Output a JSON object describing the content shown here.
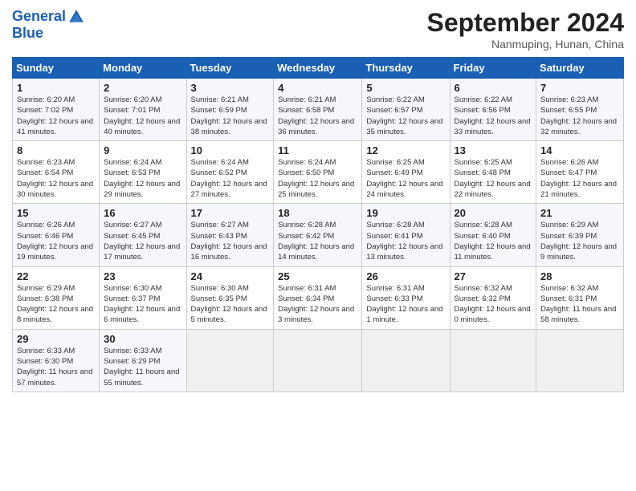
{
  "header": {
    "logo_line1": "General",
    "logo_line2": "Blue",
    "month": "September 2024",
    "location": "Nanmuping, Hunan, China"
  },
  "weekdays": [
    "Sunday",
    "Monday",
    "Tuesday",
    "Wednesday",
    "Thursday",
    "Friday",
    "Saturday"
  ],
  "weeks": [
    [
      {
        "day": "1",
        "rise": "6:20 AM",
        "set": "7:02 PM",
        "daylight": "12 hours and 41 minutes."
      },
      {
        "day": "2",
        "rise": "6:20 AM",
        "set": "7:01 PM",
        "daylight": "12 hours and 40 minutes."
      },
      {
        "day": "3",
        "rise": "6:21 AM",
        "set": "6:59 PM",
        "daylight": "12 hours and 38 minutes."
      },
      {
        "day": "4",
        "rise": "6:21 AM",
        "set": "6:58 PM",
        "daylight": "12 hours and 36 minutes."
      },
      {
        "day": "5",
        "rise": "6:22 AM",
        "set": "6:57 PM",
        "daylight": "12 hours and 35 minutes."
      },
      {
        "day": "6",
        "rise": "6:22 AM",
        "set": "6:56 PM",
        "daylight": "12 hours and 33 minutes."
      },
      {
        "day": "7",
        "rise": "6:23 AM",
        "set": "6:55 PM",
        "daylight": "12 hours and 32 minutes."
      }
    ],
    [
      {
        "day": "8",
        "rise": "6:23 AM",
        "set": "6:54 PM",
        "daylight": "12 hours and 30 minutes."
      },
      {
        "day": "9",
        "rise": "6:24 AM",
        "set": "6:53 PM",
        "daylight": "12 hours and 29 minutes."
      },
      {
        "day": "10",
        "rise": "6:24 AM",
        "set": "6:52 PM",
        "daylight": "12 hours and 27 minutes."
      },
      {
        "day": "11",
        "rise": "6:24 AM",
        "set": "6:50 PM",
        "daylight": "12 hours and 25 minutes."
      },
      {
        "day": "12",
        "rise": "6:25 AM",
        "set": "6:49 PM",
        "daylight": "12 hours and 24 minutes."
      },
      {
        "day": "13",
        "rise": "6:25 AM",
        "set": "6:48 PM",
        "daylight": "12 hours and 22 minutes."
      },
      {
        "day": "14",
        "rise": "6:26 AM",
        "set": "6:47 PM",
        "daylight": "12 hours and 21 minutes."
      }
    ],
    [
      {
        "day": "15",
        "rise": "6:26 AM",
        "set": "6:46 PM",
        "daylight": "12 hours and 19 minutes."
      },
      {
        "day": "16",
        "rise": "6:27 AM",
        "set": "6:45 PM",
        "daylight": "12 hours and 17 minutes."
      },
      {
        "day": "17",
        "rise": "6:27 AM",
        "set": "6:43 PM",
        "daylight": "12 hours and 16 minutes."
      },
      {
        "day": "18",
        "rise": "6:28 AM",
        "set": "6:42 PM",
        "daylight": "12 hours and 14 minutes."
      },
      {
        "day": "19",
        "rise": "6:28 AM",
        "set": "6:41 PM",
        "daylight": "12 hours and 13 minutes."
      },
      {
        "day": "20",
        "rise": "6:28 AM",
        "set": "6:40 PM",
        "daylight": "12 hours and 11 minutes."
      },
      {
        "day": "21",
        "rise": "6:29 AM",
        "set": "6:39 PM",
        "daylight": "12 hours and 9 minutes."
      }
    ],
    [
      {
        "day": "22",
        "rise": "6:29 AM",
        "set": "6:38 PM",
        "daylight": "12 hours and 8 minutes."
      },
      {
        "day": "23",
        "rise": "6:30 AM",
        "set": "6:37 PM",
        "daylight": "12 hours and 6 minutes."
      },
      {
        "day": "24",
        "rise": "6:30 AM",
        "set": "6:35 PM",
        "daylight": "12 hours and 5 minutes."
      },
      {
        "day": "25",
        "rise": "6:31 AM",
        "set": "6:34 PM",
        "daylight": "12 hours and 3 minutes."
      },
      {
        "day": "26",
        "rise": "6:31 AM",
        "set": "6:33 PM",
        "daylight": "12 hours and 1 minute."
      },
      {
        "day": "27",
        "rise": "6:32 AM",
        "set": "6:32 PM",
        "daylight": "12 hours and 0 minutes."
      },
      {
        "day": "28",
        "rise": "6:32 AM",
        "set": "6:31 PM",
        "daylight": "11 hours and 58 minutes."
      }
    ],
    [
      {
        "day": "29",
        "rise": "6:33 AM",
        "set": "6:30 PM",
        "daylight": "11 hours and 57 minutes."
      },
      {
        "day": "30",
        "rise": "6:33 AM",
        "set": "6:29 PM",
        "daylight": "11 hours and 55 minutes."
      },
      null,
      null,
      null,
      null,
      null
    ]
  ]
}
